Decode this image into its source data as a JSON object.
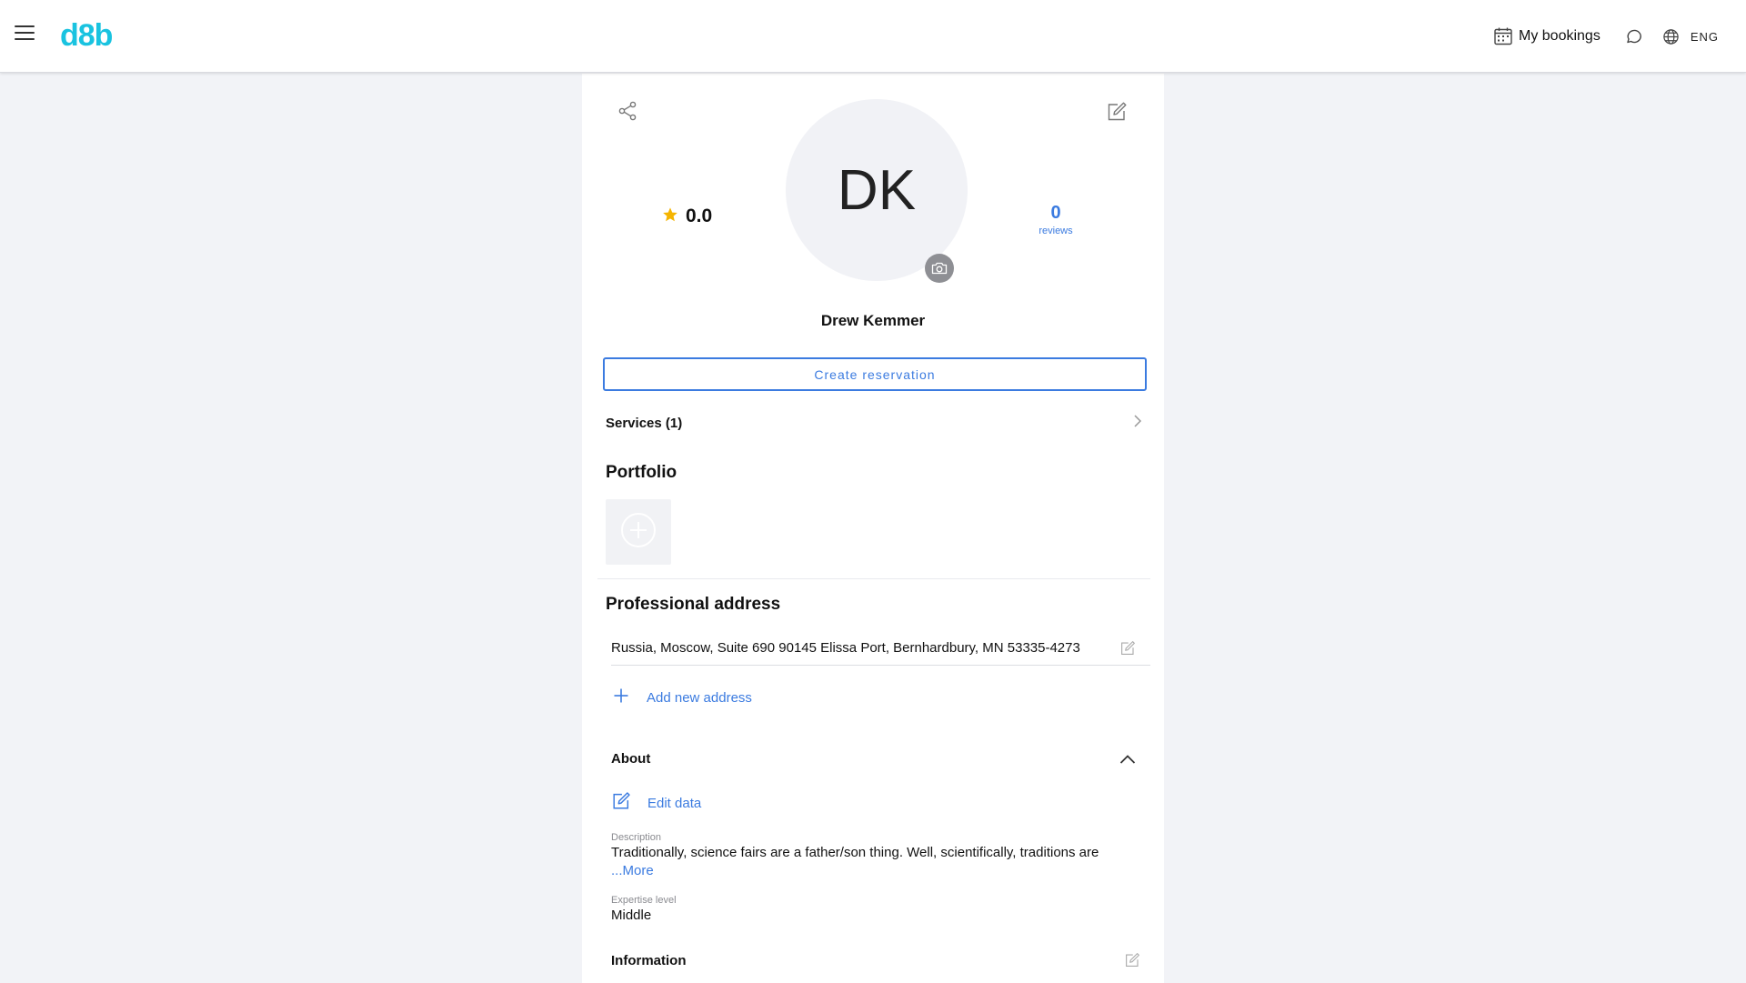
{
  "header": {
    "logo": "d8b",
    "bookings_label": "My bookings",
    "language": "ENG"
  },
  "profile": {
    "initials": "DK",
    "rating": "0.0",
    "reviews_count": "0",
    "reviews_label": "reviews",
    "name": "Drew Kemmer",
    "create_reservation_label": "Create reservation"
  },
  "services": {
    "label": "Services (1)"
  },
  "portfolio": {
    "title": "Portfolio"
  },
  "professional_address": {
    "title": "Professional address",
    "address": "Russia, Moscow, Suite 690 90145 Elissa Port, Bernhardbury, MN 53335-4273",
    "add_label": "Add new address"
  },
  "about": {
    "title": "About",
    "edit_label": "Edit data",
    "description_label": "Description",
    "description": "Traditionally, science fairs are a father/son thing. Well, scientifically, traditions are",
    "more_label": "...More",
    "expertise_label": "Expertise level",
    "expertise": "Middle"
  },
  "information": {
    "title": "Information"
  },
  "colors": {
    "accent": "#3b7be0",
    "logo": "#19c3e0",
    "star": "#f5b400",
    "background": "#f2f3f7"
  },
  "icons": [
    "menu-icon",
    "calendar-icon",
    "chat-icon",
    "globe-icon",
    "share-icon",
    "edit-icon",
    "star-icon",
    "camera-icon",
    "chevron-right-icon",
    "plus-circle-icon",
    "plus-icon",
    "chevron-up-icon"
  ]
}
